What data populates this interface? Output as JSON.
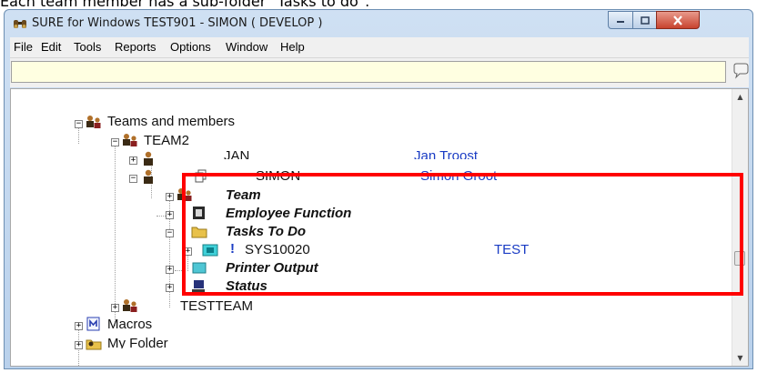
{
  "caption": "Each team member has a sub-folder \"Tasks to do\".",
  "window": {
    "title": "SURE for Windows TEST901 - SIMON ( DEVELOP )"
  },
  "menu": [
    "File",
    "Edit",
    "Tools",
    "Reports",
    "Options",
    "Window",
    "Help"
  ],
  "command_input": {
    "value": ""
  },
  "tree": {
    "items": [
      {
        "label": "Teams and members",
        "description": ""
      },
      {
        "label": "TEAM2",
        "description": ""
      },
      {
        "label": "JAN",
        "description": "Jan Troost"
      },
      {
        "label": "SIMON",
        "description": "Simon Groot"
      },
      {
        "label": "Team",
        "description": ""
      },
      {
        "label": "Employee Function",
        "description": ""
      },
      {
        "label": "Tasks To Do",
        "description": ""
      },
      {
        "label": "SYS10020",
        "description": "TEST",
        "priority_mark": "!"
      },
      {
        "label": "Printer Output",
        "description": ""
      },
      {
        "label": "Status",
        "description": ""
      },
      {
        "label": "TESTTEAM",
        "description": ""
      },
      {
        "label": "Macros",
        "description": ""
      },
      {
        "label": "My Folder",
        "description": ""
      }
    ]
  },
  "icons": {
    "app": "binoculars-icon",
    "team": "team-people-icon",
    "member": "person-icon",
    "employee_function": "id-card-icon",
    "tasks_to_do": "folder-icon",
    "task": "task-folder-icon",
    "printer_output": "printer-output-icon",
    "status": "monitor-icon",
    "macros": "macro-icon",
    "my_folder": "user-folder-icon"
  },
  "colors": {
    "description_text": "#1a3cc4",
    "highlight": "#ff0000",
    "command_input_bg": "#ffffe1",
    "close_button": "#c8432e"
  }
}
